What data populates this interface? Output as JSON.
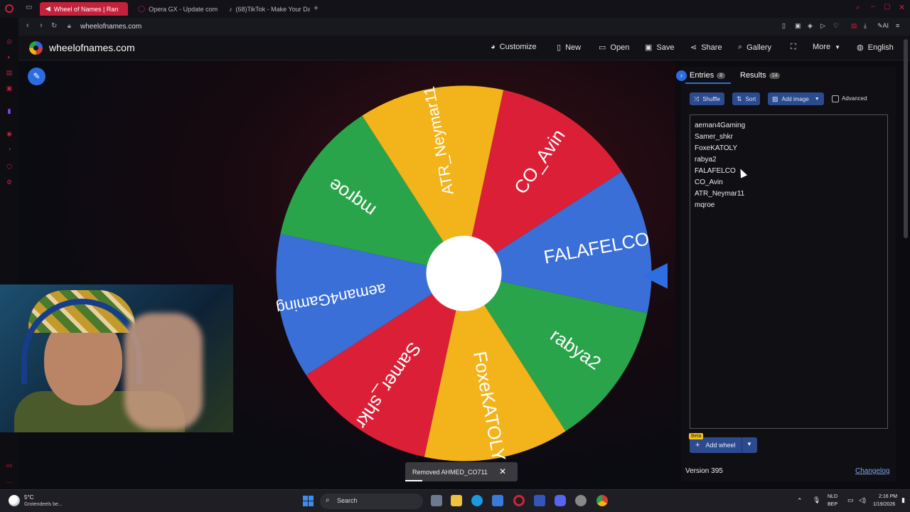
{
  "browser": {
    "tabs": [
      {
        "title": "Wheel of Names | Ran",
        "active": true
      },
      {
        "title": "Opera GX - Update comp",
        "active": false
      },
      {
        "title": "(68)TikTok - Make Your Da",
        "active": false
      }
    ],
    "url": "wheelofnames.com",
    "ai_label": "AI"
  },
  "site": {
    "name": "wheelofnames.com",
    "menu": {
      "customize": "Customize",
      "new": "New",
      "open": "Open",
      "save": "Save",
      "share": "Share",
      "gallery": "Gallery",
      "more": "More",
      "language": "English"
    }
  },
  "wheel": {
    "colors": {
      "green": "#2aa44a",
      "yellow": "#f3b31b",
      "red": "#db1f36",
      "blue": "#3a6fd8"
    },
    "segments": [
      {
        "label": "FALAFELCO",
        "color": "blue"
      },
      {
        "label": "rabya2",
        "color": "green"
      },
      {
        "label": "FoxeKATOLY",
        "color": "yellow"
      },
      {
        "label": "Samer_shkr",
        "color": "red"
      },
      {
        "label": "aeman4Gaming",
        "color": "blue"
      },
      {
        "label": "mqroe",
        "color": "green"
      },
      {
        "label": "ATR_Neymar11",
        "color": "yellow"
      },
      {
        "label": "CO_Avin",
        "color": "red"
      }
    ],
    "pointer_color": "#2d6fe0"
  },
  "panel": {
    "tabs": {
      "entries_label": "Entries",
      "entries_count": "8",
      "results_label": "Results",
      "results_count": "14"
    },
    "toolbar": {
      "shuffle": "Shuffle",
      "sort": "Sort",
      "add_image": "Add image",
      "advanced": "Advanced"
    },
    "entries": [
      "aeman4Gaming",
      "Samer_shkr",
      "FoxeKATOLY",
      "rabya2",
      "FALAFELCO",
      "CO_Avin",
      "ATR_Neymar11",
      "mqroe"
    ],
    "beta_badge": "Beta",
    "add_wheel": "Add wheel",
    "version": "Version 395",
    "changelog": "Changelog"
  },
  "toast": {
    "message": "Removed AHMED_CO711"
  },
  "taskbar": {
    "weather_temp": "5°C",
    "weather_desc": "Grotendeels be...",
    "search": "Search",
    "lang_top": "NLD",
    "lang_bottom": "BEP",
    "time": "2:16 PM",
    "date": "1/19/2026"
  }
}
